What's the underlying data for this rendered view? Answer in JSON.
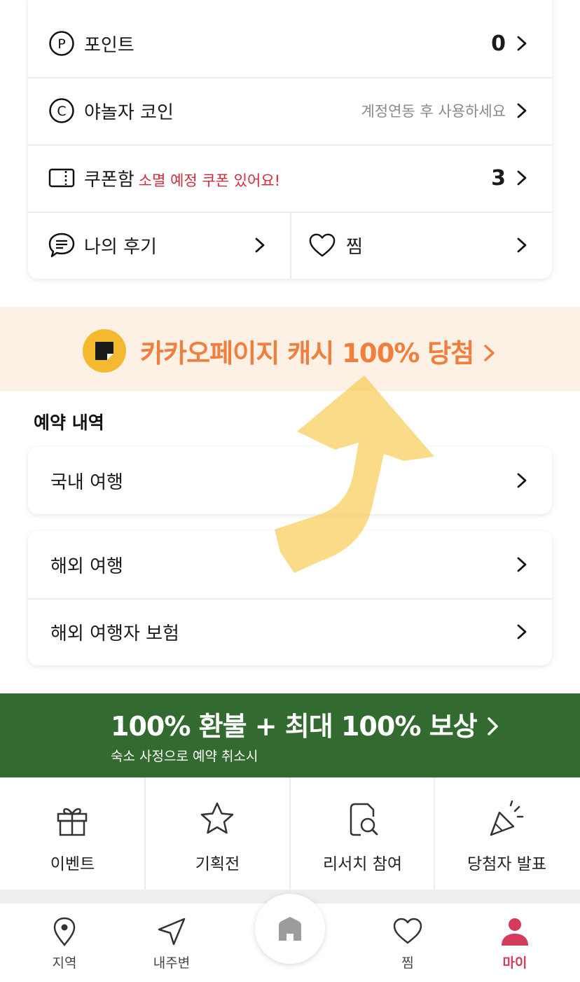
{
  "account_card": {
    "points": {
      "label": "포인트",
      "value": "0",
      "icon": "p-circle-icon"
    },
    "coin": {
      "label": "야놀자 코인",
      "value": "계정연동 후 사용하세요",
      "icon": "c-circle-icon"
    },
    "coupon": {
      "label": "쿠폰함",
      "note": "소멸 예정 쿠폰 있어요!",
      "value": "3",
      "icon": "ticket-icon"
    },
    "review": {
      "label": "나의 후기",
      "icon": "chat-icon"
    },
    "wish": {
      "label": "찜",
      "icon": "heart-icon"
    }
  },
  "kakao_banner": {
    "text": "카카오페이지 캐시 100% 당첨",
    "icon": "kakaopage-logo",
    "accent": "#f07e3d"
  },
  "reservations": {
    "title": "예약 내역",
    "domestic": "국내 여행",
    "overseas": "해외 여행",
    "insurance": "해외 여행자 보험"
  },
  "refund_banner": {
    "title": "100% 환불 + 최대 100% 보상",
    "subtitle": "숙소 사정으로 예약 취소시",
    "color": "#336a2f"
  },
  "quick_menu": [
    {
      "label": "이벤트",
      "icon": "gift-icon"
    },
    {
      "label": "기획전",
      "icon": "star-icon"
    },
    {
      "label": "리서치 참여",
      "icon": "research-icon"
    },
    {
      "label": "당첨자 발표",
      "icon": "party-icon"
    }
  ],
  "bottom_nav": {
    "region": {
      "label": "지역",
      "icon": "location-pin-icon"
    },
    "nearby": {
      "label": "내주변",
      "icon": "navigation-arrow-icon"
    },
    "home": {
      "icon": "home-icon"
    },
    "wish": {
      "label": "찜",
      "icon": "heart-icon"
    },
    "my": {
      "label": "마이",
      "icon": "person-icon",
      "active_color": "#d33a5c"
    }
  }
}
